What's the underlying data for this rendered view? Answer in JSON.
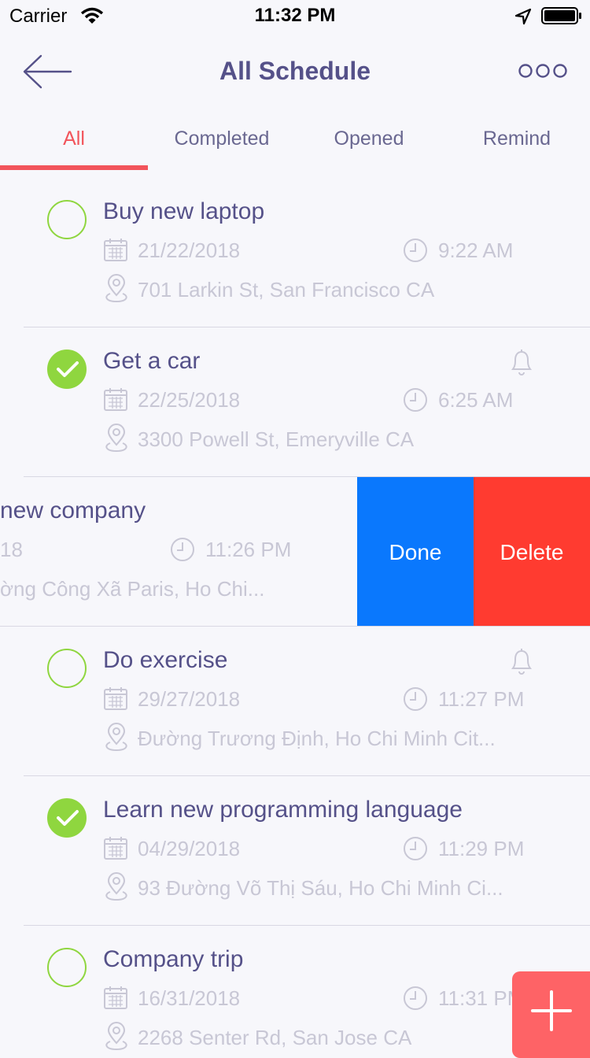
{
  "status_bar": {
    "carrier": "Carrier",
    "time": "11:32 PM"
  },
  "nav": {
    "title": "All Schedule"
  },
  "tabs": [
    {
      "label": "All"
    },
    {
      "label": "Completed"
    },
    {
      "label": "Opened"
    },
    {
      "label": "Remind"
    }
  ],
  "tasks": [
    {
      "title": "Buy new laptop",
      "date": "21/22/2018",
      "time": "9:22 AM",
      "address": "701 Larkin St, San Francisco CA",
      "done": false,
      "remind": false
    },
    {
      "title": "Get a car",
      "date": "22/25/2018",
      "time": "6:25 AM",
      "address": "3300 Powell St, Emeryville CA",
      "done": true,
      "remind": true
    },
    {
      "title": "new company",
      "date": "18",
      "time": "11:26 PM",
      "address": "ờng Công Xã Paris, Ho Chi...",
      "done": false,
      "remind": false
    },
    {
      "title": "Do exercise",
      "date": "29/27/2018",
      "time": "11:27 PM",
      "address": "Đường Trương Định, Ho Chi Minh Cit...",
      "done": false,
      "remind": true
    },
    {
      "title": "Learn new programming language",
      "date": "04/29/2018",
      "time": "11:29 PM",
      "address": "93 Đường Võ Thị Sáu, Ho Chi Minh Ci...",
      "done": true,
      "remind": false
    },
    {
      "title": "Company trip",
      "date": "16/31/2018",
      "time": "11:31 PM",
      "address": "2268 Senter Rd, San Jose CA",
      "done": false,
      "remind": false
    }
  ],
  "swipe_actions": {
    "done_label": "Done",
    "delete_label": "Delete"
  },
  "colors": {
    "accent": "#f2545b",
    "done_blue": "#0a78fd",
    "delete_red": "#ff3b30",
    "check_green": "#8fd63f",
    "title": "#555189",
    "fab": "#fe6366"
  },
  "icons": {
    "back": "arrow-left-icon",
    "more": "more-dots-icon",
    "check": "checkmark-icon",
    "bell": "bell-icon",
    "calendar": "calendar-icon",
    "clock": "clock-icon",
    "location": "location-pin-icon",
    "add": "plus-icon"
  }
}
